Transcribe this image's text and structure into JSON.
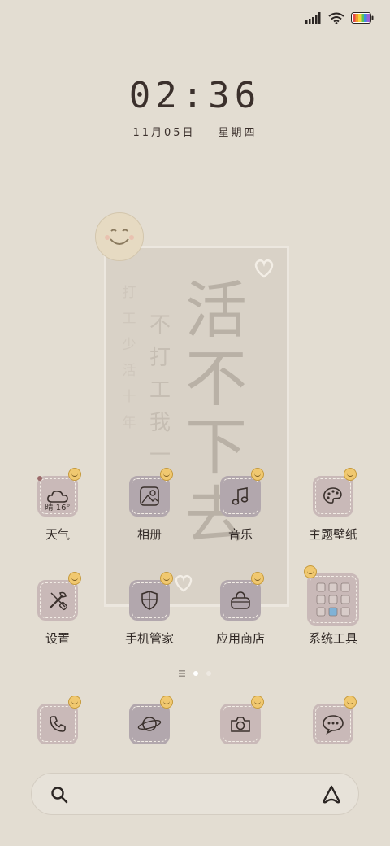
{
  "status_bar": {
    "signal_icon": "signal-bars-icon",
    "wifi_icon": "wifi-icon",
    "battery_icon": "battery-icon"
  },
  "clock": {
    "time": "02:36",
    "date": "11月05日",
    "weekday": "星期四"
  },
  "wallpaper": {
    "big_text": [
      "活",
      "不",
      "下",
      "去"
    ],
    "mid_text": [
      "不",
      "打",
      "工",
      "我",
      "一"
    ],
    "small_text": [
      "打",
      "工",
      "少",
      "活",
      "十",
      "年"
    ]
  },
  "apps": [
    {
      "label": "天气",
      "icon": "cloud-icon",
      "extra": "晴 16°"
    },
    {
      "label": "相册",
      "icon": "gallery-icon"
    },
    {
      "label": "音乐",
      "icon": "music-note-icon"
    },
    {
      "label": "主题壁纸",
      "icon": "palette-icon"
    },
    {
      "label": "设置",
      "icon": "settings-tools-icon"
    },
    {
      "label": "手机管家",
      "icon": "shield-icon"
    },
    {
      "label": "应用商店",
      "icon": "shopping-bag-icon"
    },
    {
      "label": "系统工具",
      "icon": "folder-grid-icon"
    }
  ],
  "dock": [
    {
      "icon": "phone-icon"
    },
    {
      "icon": "browser-planet-icon"
    },
    {
      "icon": "camera-icon"
    },
    {
      "icon": "message-bubble-icon"
    }
  ],
  "pager": {
    "menu_icon": "pages-menu-icon",
    "pages": 2,
    "current": 1
  },
  "search": {
    "search_icon": "search-icon",
    "assistant_icon": "assistant-a-icon"
  },
  "colors": {
    "background": "#e3ddd2",
    "tile": "#c9b9b8",
    "tile_dark": "#b2a7ad",
    "text": "#3a302c",
    "smiley": "#f0c870"
  }
}
